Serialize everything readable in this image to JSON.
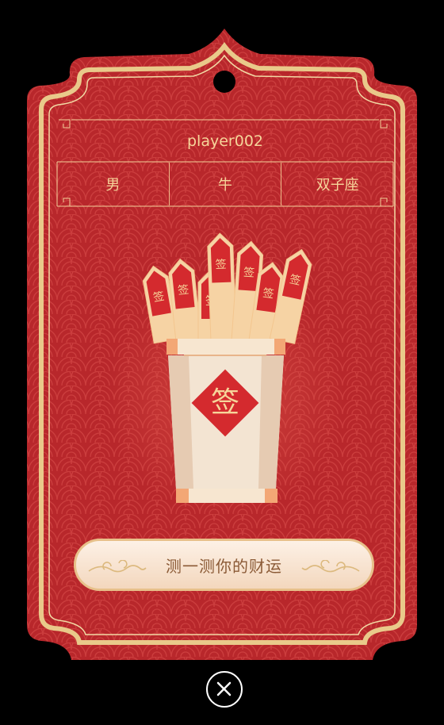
{
  "card": {
    "player_name": "player002",
    "info": [
      {
        "key": "gender",
        "value": "男"
      },
      {
        "key": "zodiac",
        "value": "牛"
      },
      {
        "key": "constellation",
        "value": "双子座"
      }
    ],
    "stick_char": "签",
    "cta_label": "测一测你的财运"
  },
  "colors": {
    "background": "#000000",
    "card_red": "#b8272b",
    "gold": "#e9c98a",
    "text_gold": "#f6d59a",
    "button_text": "#8b5a36"
  },
  "icons": {
    "close": "close-x-icon"
  }
}
